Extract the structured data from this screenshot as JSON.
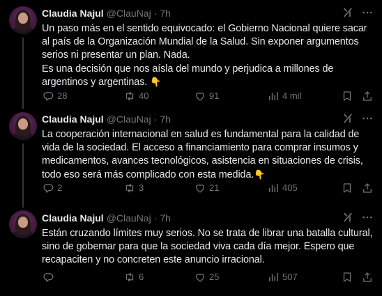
{
  "tweets": [
    {
      "author": {
        "name": "Claudia Najul",
        "handle": "@ClauNaj",
        "separator": "·",
        "time": "7h"
      },
      "text": "Un paso más en el sentido equivocado: el Gobierno Nacional quiere sacar al país de la Organización Mundial de la Salud. Sin exponer argumentos serios ni presentar un plan. Nada.\nEs una decisión que nos aísla del mundo y perjudica a millones de argentinos y argentinas. ",
      "emoji": "👇",
      "stats": {
        "replies": "28",
        "reposts": "40",
        "likes": "91",
        "views": "4 mil"
      }
    },
    {
      "author": {
        "name": "Claudia Najul",
        "handle": "@ClauNaj",
        "separator": "·",
        "time": "7h"
      },
      "text": "La cooperación internacional en salud es fundamental para la calidad de vida de la sociedad. El acceso a financiamiento para comprar insumos y medicamentos, avances tecnológicos, asistencia en situaciones de crisis, todo eso será más complicado con esta medida.",
      "emoji": "👇",
      "stats": {
        "replies": "2",
        "reposts": "3",
        "likes": "21",
        "views": "405"
      }
    },
    {
      "author": {
        "name": "Claudia Najul",
        "handle": "@ClauNaj",
        "separator": "·",
        "time": "7h"
      },
      "text": "Están cruzando límites muy serios. No se trata de librar una batalla cultural, sino de gobernar para que la sociedad viva cada día mejor. Espero que recapaciten y no concreten este anuncio irracional.",
      "emoji": "",
      "stats": {
        "replies": "",
        "reposts": "6",
        "likes": "25",
        "views": "507"
      }
    }
  ],
  "icons": {
    "reply": "reply-icon",
    "repost": "repost-icon",
    "like": "like-icon",
    "views": "views-icon",
    "bookmark": "bookmark-icon",
    "share": "share-icon",
    "grok": "grok-icon",
    "more": "more-icon"
  },
  "colors": {
    "background": "#000000",
    "text": "#e7e9ea",
    "secondary": "#71767b",
    "thread_line": "#333639",
    "emoji": "#f5c242"
  }
}
